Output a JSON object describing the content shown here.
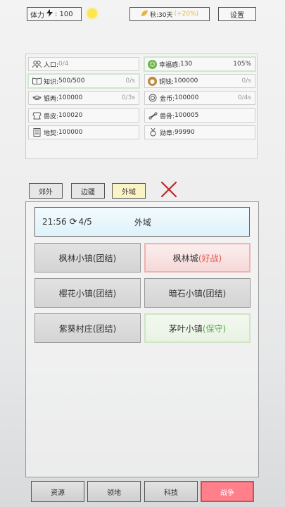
{
  "topbar": {
    "stamina_label": "体力",
    "stamina_icon": "lightning-icon",
    "stamina_value": ": 100",
    "season_text": "秋:30天",
    "season_pct": "(+20%)",
    "settings_label": "设置"
  },
  "resources": [
    {
      "name": "人口:",
      "value": "0/4",
      "value_grey": true,
      "rate": "",
      "icon": "people-icon"
    },
    {
      "name": "幸福感:",
      "value": "130",
      "rate": "105%",
      "icon": "smile-icon"
    },
    {
      "name": "知识:",
      "value": "500/500",
      "rate": "0/s",
      "icon": "book-icon"
    },
    {
      "name": "铜钱:",
      "value": "100000",
      "rate": "0/s",
      "icon": "coin-icon"
    },
    {
      "name": "银两:",
      "value": "100000",
      "rate": "0/3s",
      "icon": "silver-icon"
    },
    {
      "name": "金币:",
      "value": "100000",
      "rate": "0/4s",
      "icon": "gold-icon"
    },
    {
      "name": "兽皮:",
      "value": "100020",
      "rate": "",
      "icon": "hide-icon"
    },
    {
      "name": "兽骨:",
      "value": "100005",
      "rate": "",
      "icon": "bone-icon"
    },
    {
      "name": "地契:",
      "value": "100000",
      "rate": "",
      "icon": "deed-icon"
    },
    {
      "name": "勋章:",
      "value": "99990",
      "rate": "",
      "icon": "medal-icon"
    }
  ],
  "tabs": [
    "郊外",
    "边疆",
    "外域"
  ],
  "header": {
    "time": "21:56",
    "count": "4/5",
    "region": "外域"
  },
  "towns": [
    {
      "name": "枫林小镇",
      "status": "(团结)"
    },
    {
      "name": "枫林城",
      "status": "(好战)"
    },
    {
      "name": "樱花小镇",
      "status": "(团结)"
    },
    {
      "name": "暗石小镇",
      "status": "(团结)"
    },
    {
      "name": "紫葵村庄",
      "status": "(团结)"
    },
    {
      "name": "茅叶小镇",
      "status": "(保守)"
    }
  ],
  "nav": [
    "资源",
    "领地",
    "科技",
    "战争"
  ],
  "colors": {
    "accent_red": "#ff7f8a",
    "hostile": "#e35b4e",
    "conservative": "#5aa84d",
    "active_tab": "#faf3c4"
  }
}
